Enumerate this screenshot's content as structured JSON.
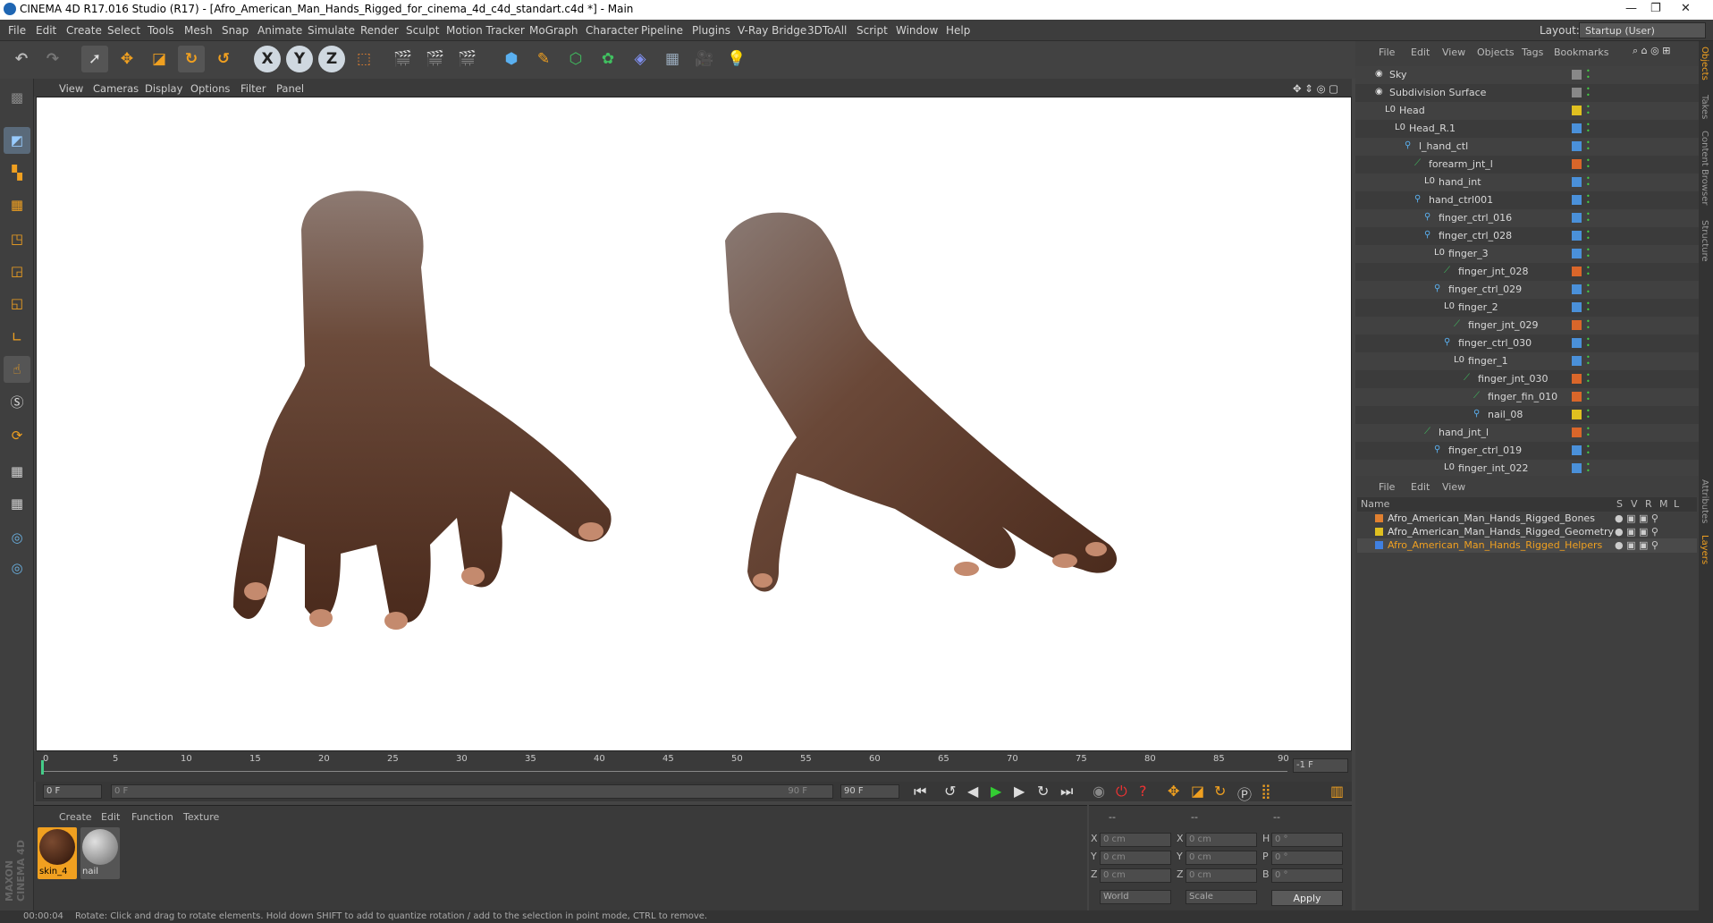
{
  "app": {
    "title": "CINEMA 4D R17.016 Studio (R17) - [Afro_American_Man_Hands_Rigged_for_cinema_4d_c4d_standart.c4d *] - Main"
  },
  "menu": [
    "File",
    "Edit",
    "Create",
    "Select",
    "Tools",
    "Mesh",
    "Snap",
    "Animate",
    "Simulate",
    "Render",
    "Sculpt",
    "Motion Tracker",
    "MoGraph",
    "Character",
    "Pipeline",
    "Plugins",
    "V-Ray Bridge",
    "3DToAll",
    "Script",
    "Window",
    "Help"
  ],
  "layout": {
    "label": "Layout:",
    "value": "Startup (User)"
  },
  "viewport": {
    "menu": [
      "View",
      "Cameras",
      "Display",
      "Options",
      "Filter",
      "Panel"
    ]
  },
  "objects": {
    "menu": [
      "File",
      "Edit",
      "View",
      "Objects",
      "Tags",
      "Bookmarks"
    ],
    "items": [
      {
        "name": "Sky",
        "level": 0,
        "color": "#d8d8d8"
      },
      {
        "name": "Subdivision Surface",
        "level": 0,
        "color": "#d8d8d8"
      },
      {
        "name": "Head",
        "level": 1,
        "color": "#d8d8d8"
      },
      {
        "name": "Head_R.1",
        "level": 2,
        "color": "#d8d8d8"
      },
      {
        "name": "l_hand_ctl",
        "level": 3,
        "color": "#d8d8d8"
      },
      {
        "name": "forearm_jnt_l",
        "level": 4,
        "color": "#d8d8d8"
      },
      {
        "name": "hand_int",
        "level": 5,
        "color": "#d8d8d8"
      },
      {
        "name": "hand_ctrl001",
        "level": 4,
        "color": "#d8d8d8"
      },
      {
        "name": "finger_ctrl_016",
        "level": 5,
        "color": "#d8d8d8"
      },
      {
        "name": "finger_ctrl_028",
        "level": 5,
        "color": "#d8d8d8"
      },
      {
        "name": "finger_3",
        "level": 6,
        "color": "#d8d8d8"
      },
      {
        "name": "finger_jnt_028",
        "level": 7,
        "color": "#d8d8d8"
      },
      {
        "name": "finger_ctrl_029",
        "level": 6,
        "color": "#d8d8d8"
      },
      {
        "name": "finger_2",
        "level": 7,
        "color": "#d8d8d8"
      },
      {
        "name": "finger_jnt_029",
        "level": 8,
        "color": "#d8d8d8"
      },
      {
        "name": "finger_ctrl_030",
        "level": 7,
        "color": "#d8d8d8"
      },
      {
        "name": "finger_1",
        "level": 8,
        "color": "#d8d8d8"
      },
      {
        "name": "finger_jnt_030",
        "level": 9,
        "color": "#d8d8d8"
      },
      {
        "name": "finger_fin_010",
        "level": 10,
        "color": "#d8d8d8"
      },
      {
        "name": "nail_08",
        "level": 10,
        "color": "#d8d8d8"
      },
      {
        "name": "hand_jnt_l",
        "level": 5,
        "color": "#d8d8d8"
      },
      {
        "name": "finger_ctrl_019",
        "level": 6,
        "color": "#d8d8d8"
      },
      {
        "name": "finger_int_022",
        "level": 7,
        "color": "#d8d8d8"
      }
    ]
  },
  "layers": {
    "menu": [
      "File",
      "Edit",
      "View"
    ],
    "header": {
      "name": "Name",
      "s": "S",
      "v": "V",
      "r": "R",
      "m": "M",
      "l": "L"
    },
    "items": [
      {
        "name": "Afro_American_Man_Hands_Rigged_Bones",
        "color": "#e08030"
      },
      {
        "name": "Afro_American_Man_Hands_Rigged_Geometry",
        "color": "#e0c020"
      },
      {
        "name": "Afro_American_Man_Hands_Rigged_Helpers",
        "color": "#4080e0"
      }
    ]
  },
  "timeline": {
    "ticks": [
      "0",
      "5",
      "10",
      "15",
      "20",
      "25",
      "30",
      "35",
      "40",
      "45",
      "50",
      "55",
      "60",
      "65",
      "70",
      "75",
      "80",
      "85",
      "90"
    ],
    "end_label": "-1 F",
    "start_field": "0 F",
    "range_start": "0 F",
    "range_end": "90 F",
    "end_field": "90 F"
  },
  "materials": {
    "menu": [
      "Create",
      "Edit",
      "Function",
      "Texture"
    ],
    "items": [
      {
        "name": "skin_4"
      },
      {
        "name": "nail"
      }
    ]
  },
  "coords": {
    "headers": [
      "--",
      "--",
      "--"
    ],
    "rows": [
      {
        "a": "X",
        "av": "0 cm",
        "b": "X",
        "bv": "0 cm",
        "c": "H",
        "cv": "0 °"
      },
      {
        "a": "Y",
        "av": "0 cm",
        "b": "Y",
        "bv": "0 cm",
        "c": "P",
        "cv": "0 °"
      },
      {
        "a": "Z",
        "av": "0 cm",
        "b": "Z",
        "bv": "0 cm",
        "c": "B",
        "cv": "0 °"
      }
    ],
    "world": "World",
    "scale": "Scale",
    "apply": "Apply"
  },
  "status": {
    "time": "00:00:04",
    "text": "Rotate: Click and drag to rotate elements. Hold down SHIFT to add to quantize rotation / add to the selection in point mode, CTRL to remove."
  },
  "side_tabs": [
    "Objects",
    "Takes",
    "Content Browser",
    "Structure",
    "Attributes",
    "Layers"
  ],
  "brand": {
    "line1": "MAXON",
    "line2": "CINEMA 4D"
  }
}
